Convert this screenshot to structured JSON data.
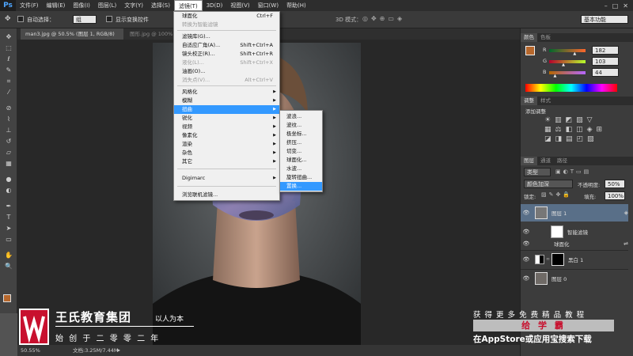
{
  "menubar": {
    "logo": "Ps",
    "items": [
      "文件(F)",
      "编辑(E)",
      "图像(I)",
      "图层(L)",
      "文字(Y)",
      "选择(S)",
      "滤镜(T)",
      "3D(D)",
      "视图(V)",
      "窗口(W)",
      "帮助(H)"
    ]
  },
  "options": {
    "auto_select_label": "自动选择：",
    "auto_select_value": "组",
    "show_transform": "显示变换控件",
    "mode_3d": "3D 模式：",
    "workspace": "基本功能"
  },
  "tabs": {
    "active": "man3.jpg @ 50.5% (图层 1, RGB/8) * ×",
    "inactive": "图形.jpg @ 100%"
  },
  "filter_menu": {
    "items": [
      {
        "label": "球面化",
        "shortcut": "Ctrl+F"
      },
      {
        "label": "转换为智能滤镜"
      },
      {
        "label": "滤镜库(G)..."
      },
      {
        "label": "自适应广角(A)...",
        "shortcut": "Shift+Ctrl+A"
      },
      {
        "label": "镜头校正(R)...",
        "shortcut": "Shift+Ctrl+R"
      },
      {
        "label": "液化(L)...",
        "shortcut": "Shift+Ctrl+X"
      },
      {
        "label": "油画(O)..."
      },
      {
        "label": "消失点(V)...",
        "shortcut": "Alt+Ctrl+V"
      },
      {
        "label": "风格化"
      },
      {
        "label": "模糊"
      },
      {
        "label": "扭曲"
      },
      {
        "label": "锐化"
      },
      {
        "label": "视频"
      },
      {
        "label": "像素化"
      },
      {
        "label": "渲染"
      },
      {
        "label": "杂色"
      },
      {
        "label": "其它"
      },
      {
        "label": "Digimarc"
      },
      {
        "label": "浏览联机滤镜..."
      }
    ]
  },
  "distort_submenu": {
    "items": [
      "波浪...",
      "波纹...",
      "极坐标...",
      "挤压...",
      "切变...",
      "球面化...",
      "水波...",
      "旋转扭曲...",
      "置换..."
    ]
  },
  "color_panel": {
    "tabs": [
      "颜色",
      "色板"
    ],
    "r_label": "R",
    "g_label": "G",
    "b_label": "B",
    "r": "182",
    "g": "103",
    "b": "44",
    "r_fraction": 0.714,
    "g_fraction": 0.404,
    "b_fraction": 0.173,
    "fg_color": "#b6672c"
  },
  "adjust_panel": {
    "tabs": [
      "调整",
      "样式"
    ],
    "title": "添加调整"
  },
  "layers_panel": {
    "tabs": [
      "图层",
      "通道",
      "路径"
    ],
    "kind": "类型",
    "blend": "颜色加深",
    "opacity_label": "不透明度:",
    "opacity": "50%",
    "lock_label": "锁定:",
    "fill_label": "填充:",
    "fill": "100%",
    "layers": [
      "图层 1",
      "智能滤镜",
      "球面化",
      "黑白 1",
      "图层 0"
    ]
  },
  "status": {
    "zoom": "50.55%",
    "doc": "文档:3.25M/7.44M"
  },
  "watermark": {
    "company": "王氏教育集团",
    "slogan": "以人为本",
    "founded": "始 创 于 二 零 零 二 年",
    "promo_line1": "获 得 更 多 免 费 精 品 教 程",
    "promo_app": "给 学 霸",
    "promo_line2": "在AppStore或应用宝搜索下载"
  },
  "colors": {
    "accent_blue": "#3399ff",
    "menubar": "#2d2d2d",
    "panel": "#3c3c3c",
    "brand_red": "#c8102e"
  }
}
